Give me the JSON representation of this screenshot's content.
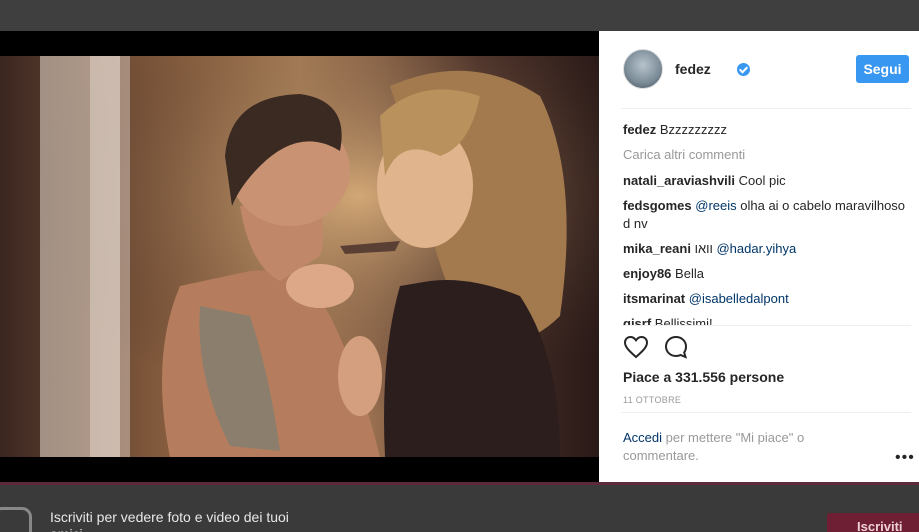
{
  "post": {
    "username": "fedez",
    "follow_label": "Segui",
    "caption_user": "fedez",
    "caption_text": "Bzzzzzzzzz",
    "load_more": "Carica altri commenti",
    "comments": [
      {
        "user": "natali_araviashvili",
        "text": "Cool pic",
        "mention": ""
      },
      {
        "user": "fedsgomes",
        "text": "olha ai o cabelo maravilhoso d nv",
        "mention": "@reeis"
      },
      {
        "user": "mika_reani",
        "text": "וואו",
        "mention": "@hadar.yihya"
      },
      {
        "user": "enjoy86",
        "text": "Bella",
        "mention": ""
      },
      {
        "user": "itsmarinat",
        "text": "",
        "mention": "@isabelledalpont"
      },
      {
        "user": "gisrf",
        "text": "Bellissimi!",
        "mention": ""
      }
    ],
    "likes": "Piace a 331.556 persone",
    "date": "11 OTTOBRE",
    "login_link": "Accedi",
    "login_text": "per mettere \"Mi piace\" o commentare.",
    "more_icon": "•••"
  },
  "banner": {
    "text": "Iscriviti per vedere foto e video dei tuoi amici.",
    "signup_label": "Iscriviti"
  },
  "colors": {
    "accent": "#3897f0",
    "link": "#003569",
    "banner_button": "#6e1f33"
  },
  "icons": [
    "verified-badge-icon",
    "heart-icon",
    "comment-bubble-icon",
    "instagram-logo-icon",
    "more-options-icon"
  ]
}
